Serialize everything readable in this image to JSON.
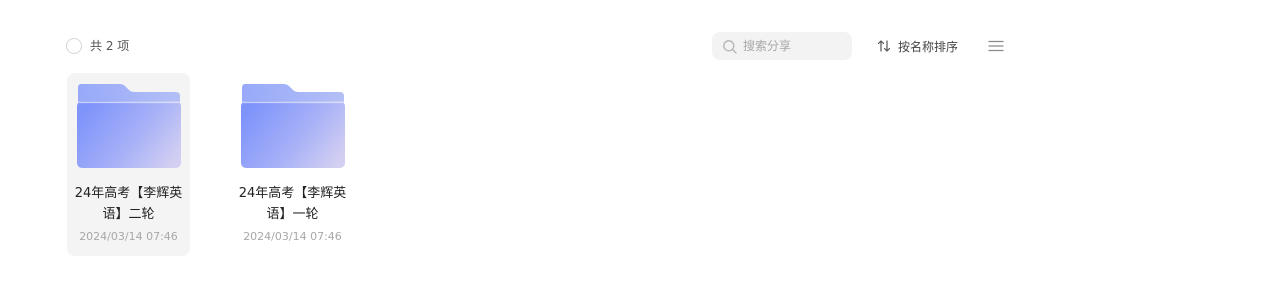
{
  "toolbar": {
    "count_label": "共 2 项",
    "search_placeholder": "搜索分享",
    "sort_label": "按名称排序",
    "icons": {
      "select": "circle-checkbox-icon",
      "search": "search-icon",
      "sort": "sort-arrows-icon",
      "view": "list-view-icon"
    }
  },
  "colors": {
    "folder_back": "#9fb1f8",
    "folder_front_start": "#8096fb",
    "folder_front_end": "#cfcbf1",
    "selected_card_bg": "#f4f4f4"
  },
  "files": [
    {
      "name": "24年高考【李辉英语】二轮",
      "date": "2024/03/14 07:46",
      "icon": "folder-icon",
      "selected": true
    },
    {
      "name": "24年高考【李辉英语】一轮",
      "date": "2024/03/14 07:46",
      "icon": "folder-icon",
      "selected": false
    }
  ]
}
